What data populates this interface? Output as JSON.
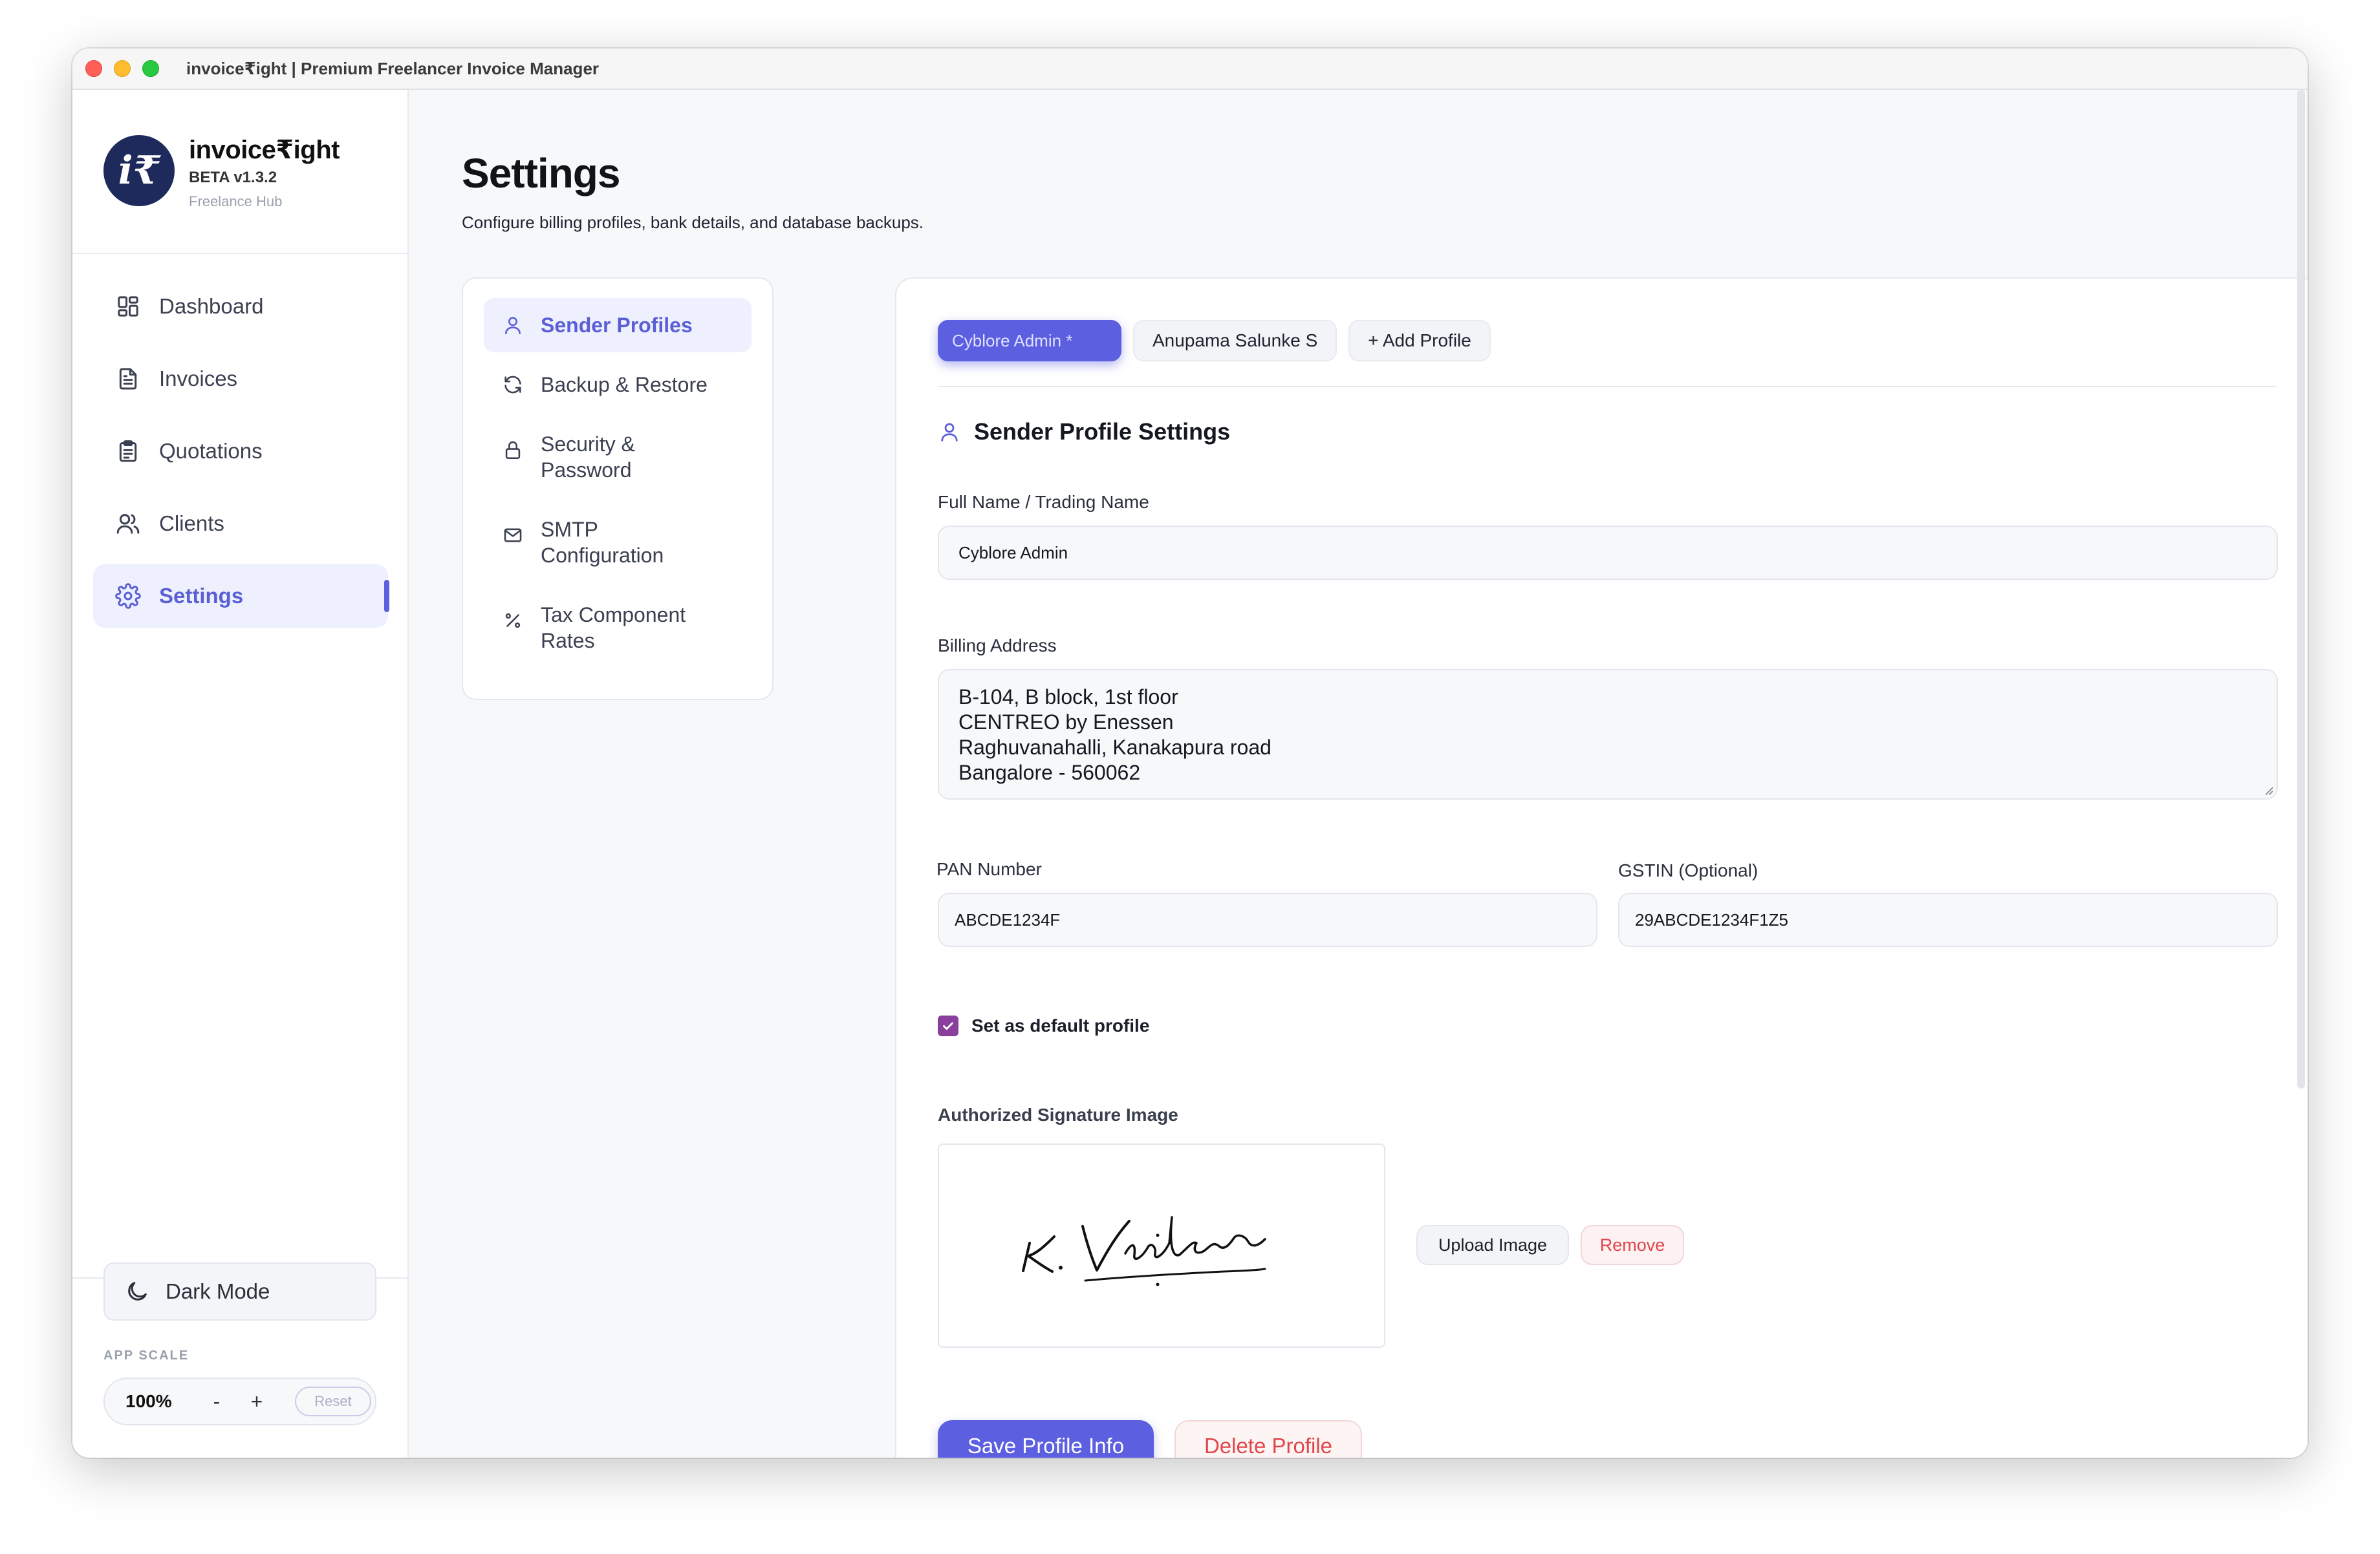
{
  "window": {
    "title": "invoice₹ight | Premium Freelancer Invoice Manager"
  },
  "brand": {
    "logo_text": "i₹",
    "name": "invoice₹ight",
    "version": "BETA v1.3.2",
    "tagline": "Freelance Hub"
  },
  "sidebar": {
    "items": [
      {
        "label": "Dashboard",
        "icon": "grid-icon",
        "active": false
      },
      {
        "label": "Invoices",
        "icon": "file-icon",
        "active": false
      },
      {
        "label": "Quotations",
        "icon": "clipboard-icon",
        "active": false
      },
      {
        "label": "Clients",
        "icon": "users-icon",
        "active": false
      },
      {
        "label": "Settings",
        "icon": "gear-icon",
        "active": true
      }
    ],
    "dark_mode_label": "Dark Mode",
    "app_scale_label": "APP SCALE",
    "scale_value": "100%",
    "scale_minus": "-",
    "scale_plus": "+",
    "scale_reset": "Reset"
  },
  "page": {
    "title": "Settings",
    "subtitle": "Configure billing profiles, bank details, and database backups."
  },
  "settings_nav": [
    {
      "label": "Sender Profiles",
      "icon": "user-icon",
      "active": true
    },
    {
      "label": "Backup & Restore",
      "icon": "refresh-icon",
      "active": false
    },
    {
      "label": "Security &\nPassword",
      "icon": "lock-icon",
      "active": false
    },
    {
      "label": "SMTP\nConfiguration",
      "icon": "mail-icon",
      "active": false
    },
    {
      "label": "Tax Component\nRates",
      "icon": "percent-icon",
      "active": false
    }
  ],
  "profile_tabs": [
    {
      "label": "Cyblore Admin *",
      "active": true
    },
    {
      "label": "Anupama Salunke S",
      "active": false
    },
    {
      "label": "+ Add Profile",
      "active": false
    }
  ],
  "form": {
    "section_title": "Sender Profile Settings",
    "full_name_label": "Full Name / Trading Name",
    "full_name_value": "Cyblore Admin",
    "billing_address_label": "Billing Address",
    "billing_address_value": "B-104, B block, 1st floor\nCENTREO by Enessen\nRaghuvanahalli, Kanakapura road\nBangalore - 560062",
    "pan_label": "PAN Number",
    "pan_value": "ABCDE1234F",
    "gstin_label": "GSTIN (Optional)",
    "gstin_value": "29ABCDE1234F1Z5",
    "default_profile_label": "Set as default profile",
    "default_profile_checked": true,
    "signature_label": "Authorized Signature Image",
    "upload_button": "Upload Image",
    "remove_button": "Remove",
    "save_button": "Save Profile Info",
    "delete_button": "Delete Profile"
  },
  "colors": {
    "accent": "#5b5fe0",
    "danger": "#e0474c",
    "checkbox": "#8a3f9c",
    "logo_bg": "#1f2a5c",
    "logo_accent": "#f5b335"
  }
}
